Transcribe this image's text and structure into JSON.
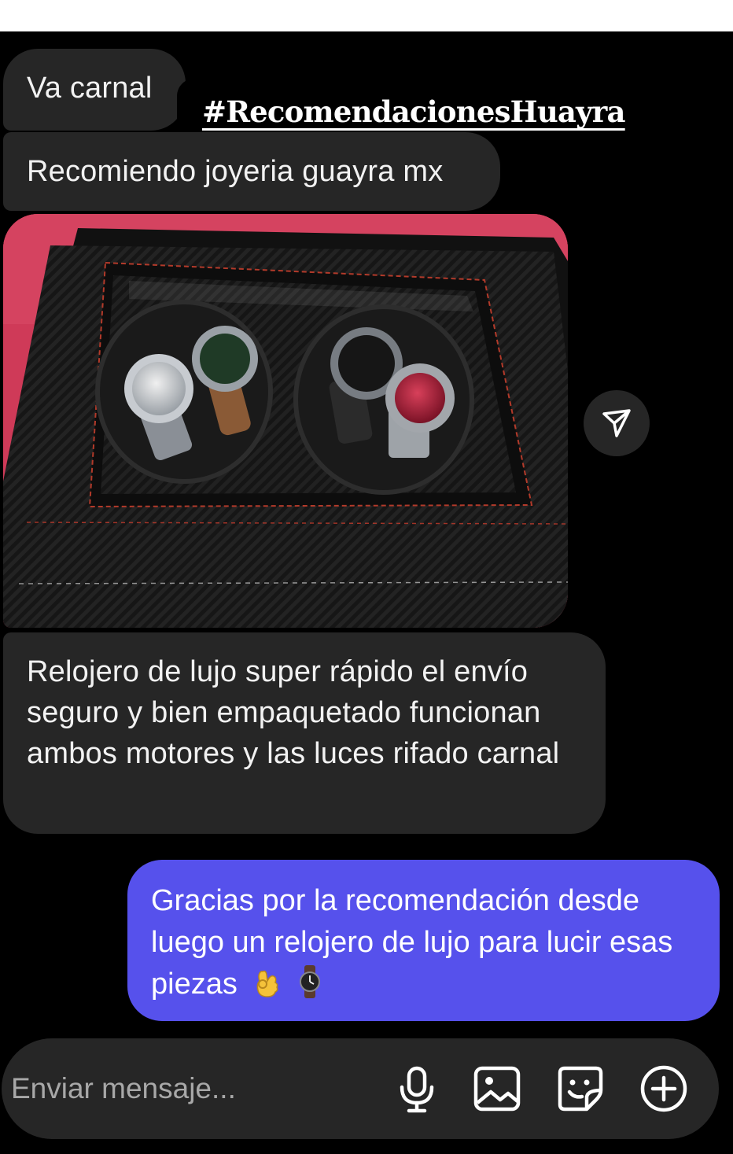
{
  "messages": {
    "incoming_1": "Va carnal",
    "incoming_2": "Recomiendo joyeria guayra mx",
    "incoming_3": "Relojero de lujo super rápido el envío seguro y bien empaquetado funcionan ambos motores y las luces rifado carnal",
    "outgoing_1": "Gracias por la recomendación desde luego un relojero de lujo para lucir esas piezas"
  },
  "overlay": {
    "hashtag": "#RecomendacionesHuayra"
  },
  "outgoing_emojis": [
    "ok-hand-emoji",
    "watch-emoji"
  ],
  "shared_photo": {
    "subject": "watch-winder-box"
  },
  "composer": {
    "placeholder": "Enviar mensaje...",
    "icons": [
      "microphone-icon",
      "gallery-icon",
      "sticker-icon",
      "add-icon"
    ]
  },
  "colors": {
    "background": "#000000",
    "incoming_bubble": "#262626",
    "outgoing_bubble": "#5651ec",
    "text": "#f2f2f2"
  }
}
